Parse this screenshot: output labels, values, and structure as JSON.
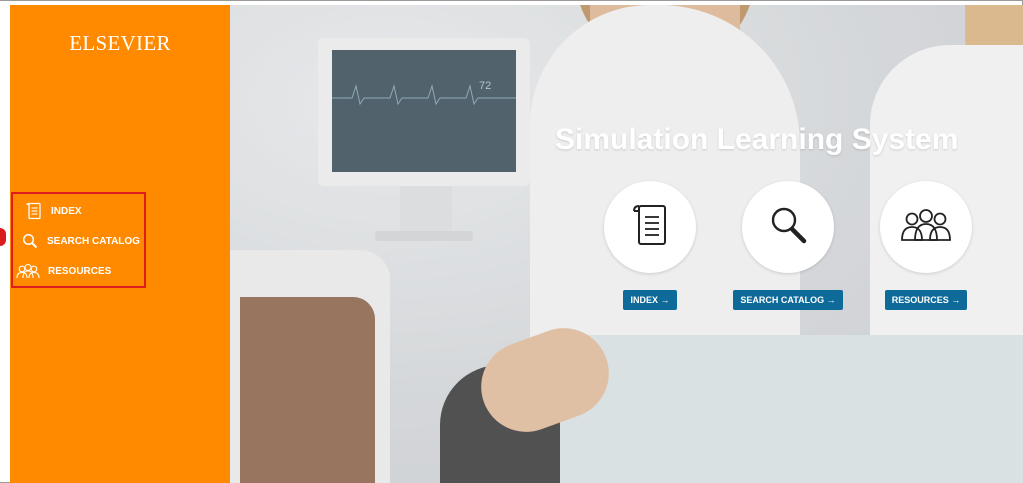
{
  "brand": {
    "logo_text": "ELSEVIER"
  },
  "sidebar": {
    "items": [
      {
        "label": "INDEX",
        "icon": "scroll-icon"
      },
      {
        "label": "SEARCH CATALOG",
        "icon": "magnifier-icon"
      },
      {
        "label": "RESOURCES",
        "icon": "people-icon"
      }
    ]
  },
  "hero": {
    "title": "Simulation Learning System",
    "monitor_reading": "72",
    "tiles": [
      {
        "label": "INDEX →",
        "icon": "scroll-icon"
      },
      {
        "label": "SEARCH CATALOG →",
        "icon": "magnifier-icon"
      },
      {
        "label": "RESOURCES →",
        "icon": "people-icon"
      }
    ]
  },
  "colors": {
    "sidebar_bg": "#ff8a00",
    "button_bg": "#0d6a99",
    "highlight_border": "#e01c1c",
    "text_on_color": "#ffffff"
  }
}
